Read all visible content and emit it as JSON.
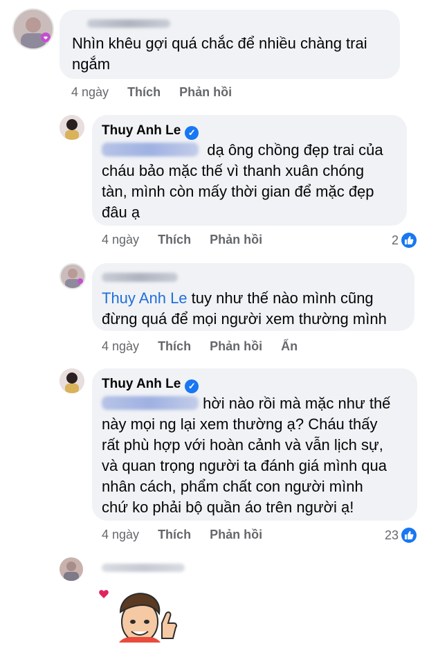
{
  "comments": [
    {
      "id": "c1",
      "text_lines": [
        "Nhìn khêu gợi quá chắc để nhiều chàng trai",
        "ngắm"
      ],
      "meta": {
        "time": "4 ngày",
        "like": "Thích",
        "reply": "Phản hồi"
      }
    },
    {
      "id": "c2",
      "author": "Thuy Anh Le",
      "text_first": "dạ ông chồng đẹp trai của",
      "text_rest": [
        "cháu bảo mặc thế vì thanh xuân chóng",
        "tàn, mình còn mấy thời gian để mặc đẹp",
        "đâu ạ"
      ],
      "meta": {
        "time": "4 ngày",
        "like": "Thích",
        "reply": "Phản hồi"
      },
      "reaction_count": "2"
    },
    {
      "id": "c3",
      "mention": "Thuy Anh Le",
      "text_first": " tuy như thế nào mình cũng",
      "text_rest": [
        "đừng quá để mọi người xem thường mình"
      ],
      "meta": {
        "time": "4 ngày",
        "like": "Thích",
        "reply": "Phản hồi",
        "hide": "Ẩn"
      }
    },
    {
      "id": "c4",
      "author": "Thuy Anh Le",
      "text_first": "hời nào rồi mà mặc như thế",
      "text_rest": [
        "này mọi ng lại xem thường ạ? Cháu thấy",
        "rất phù hợp với hoàn cảnh và vẫn lịch sự,",
        "và quan trọng người ta đánh giá mình qua",
        "nhân cách, phẩm chất con người mình",
        "chứ ko phải bộ quần áo trên người ạ!"
      ],
      "meta": {
        "time": "4 ngày",
        "like": "Thích",
        "reply": "Phản hồi"
      },
      "reaction_count": "23"
    }
  ],
  "colors": {
    "bubble": "#f0f2f5",
    "meta": "#65676b",
    "mention": "#216fdb",
    "like": "#1877f2",
    "heart": "#e0245e"
  }
}
